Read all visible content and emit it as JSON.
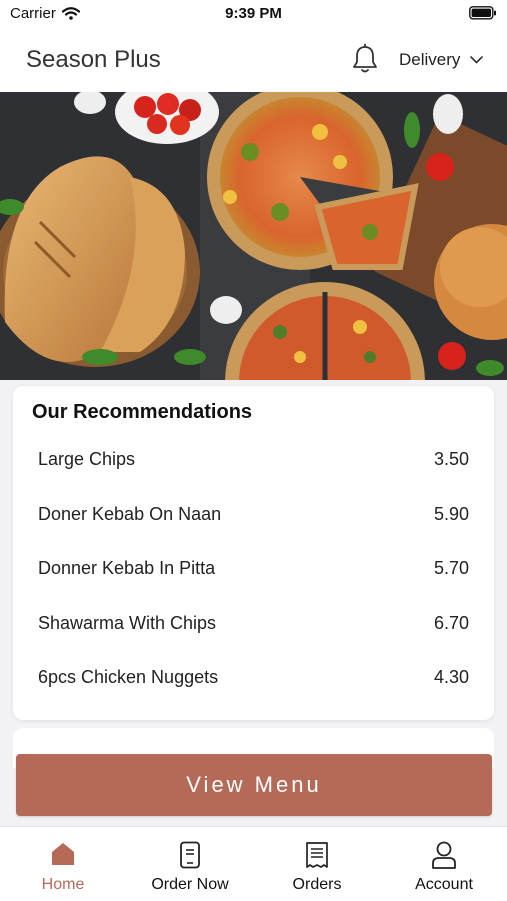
{
  "status_bar": {
    "carrier": "Carrier",
    "time": "9:39 PM"
  },
  "header": {
    "title": "Season Plus",
    "delivery_label": "Delivery"
  },
  "recommendations": {
    "title": "Our Recommendations",
    "items": [
      {
        "name": "Large Chips",
        "price": "3.50"
      },
      {
        "name": "Doner Kebab On Naan",
        "price": "5.90"
      },
      {
        "name": "Donner Kebab In Pitta",
        "price": "5.70"
      },
      {
        "name": "Shawarma With Chips",
        "price": "6.70"
      },
      {
        "name": "6pcs Chicken Nuggets",
        "price": "4.30"
      }
    ]
  },
  "view_menu_label": "View Menu",
  "tabs": [
    {
      "label": "Home",
      "icon": "home-icon",
      "active": true
    },
    {
      "label": "Order Now",
      "icon": "order-icon",
      "active": false
    },
    {
      "label": "Orders",
      "icon": "receipt-icon",
      "active": false
    },
    {
      "label": "Account",
      "icon": "user-icon",
      "active": false
    }
  ],
  "colors": {
    "accent": "#b56a58",
    "background": "#f2f2f4"
  }
}
